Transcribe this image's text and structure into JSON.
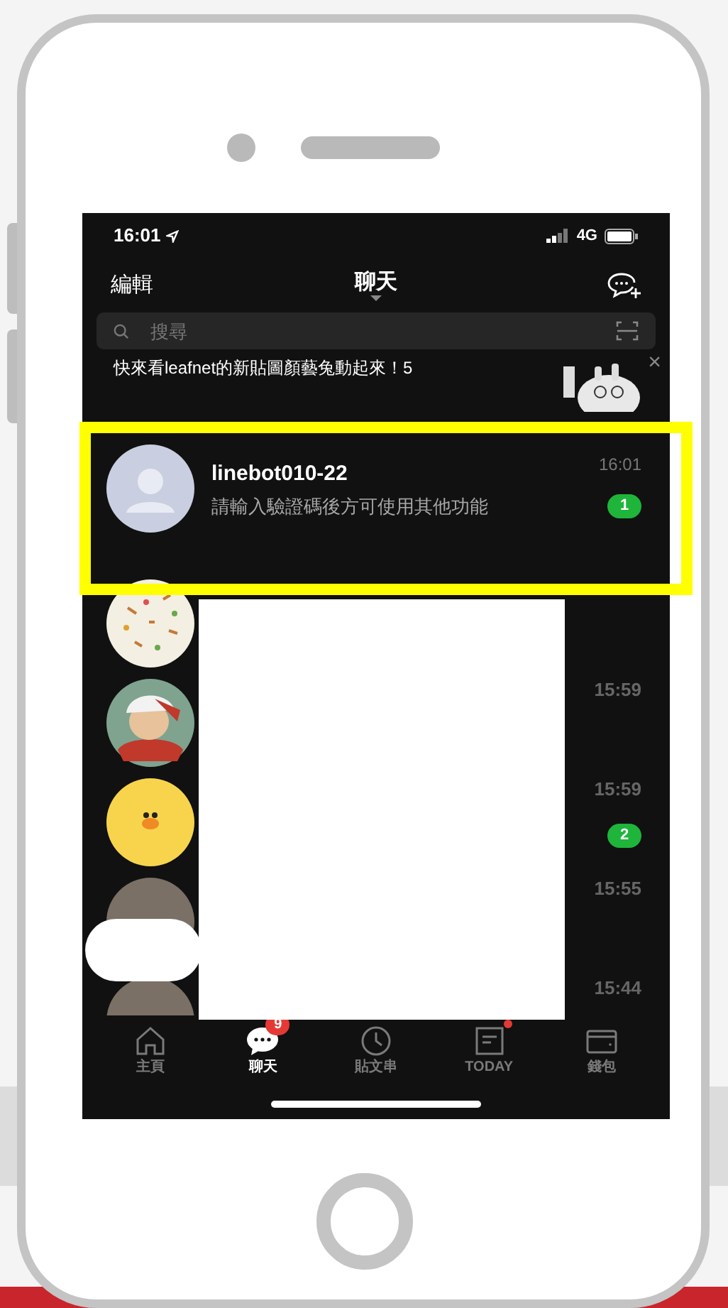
{
  "status_bar": {
    "time": "16:01",
    "network": "4G"
  },
  "header": {
    "left": "編輯",
    "title": "聊天"
  },
  "search": {
    "placeholder": "搜尋"
  },
  "banner": {
    "text": "快來看leafnet的新貼圖顏藝兔動起來！5",
    "close": "×"
  },
  "highlighted_chat": {
    "name": "linebot010-22",
    "message": "請輸入驗證碼後方可使用其他功能",
    "time": "16:01",
    "unread": "1"
  },
  "chats": [
    {
      "kind": "pattern"
    },
    {
      "kind": "cartoon",
      "time": "15:59"
    },
    {
      "kind": "chick",
      "time": "15:59",
      "unread": "2"
    },
    {
      "kind": "photo",
      "time": "15:55"
    },
    {
      "kind": "photo",
      "time": "15:44"
    }
  ],
  "tabs": [
    {
      "kind": "home",
      "label": "主頁",
      "selected": false
    },
    {
      "kind": "chat",
      "label": "聊天",
      "selected": true,
      "badge": "9"
    },
    {
      "kind": "clock",
      "label": "貼文串",
      "selected": false
    },
    {
      "kind": "news",
      "label": "TODAY",
      "selected": false,
      "dot": true
    },
    {
      "kind": "wallet",
      "label": "錢包",
      "selected": false
    }
  ]
}
